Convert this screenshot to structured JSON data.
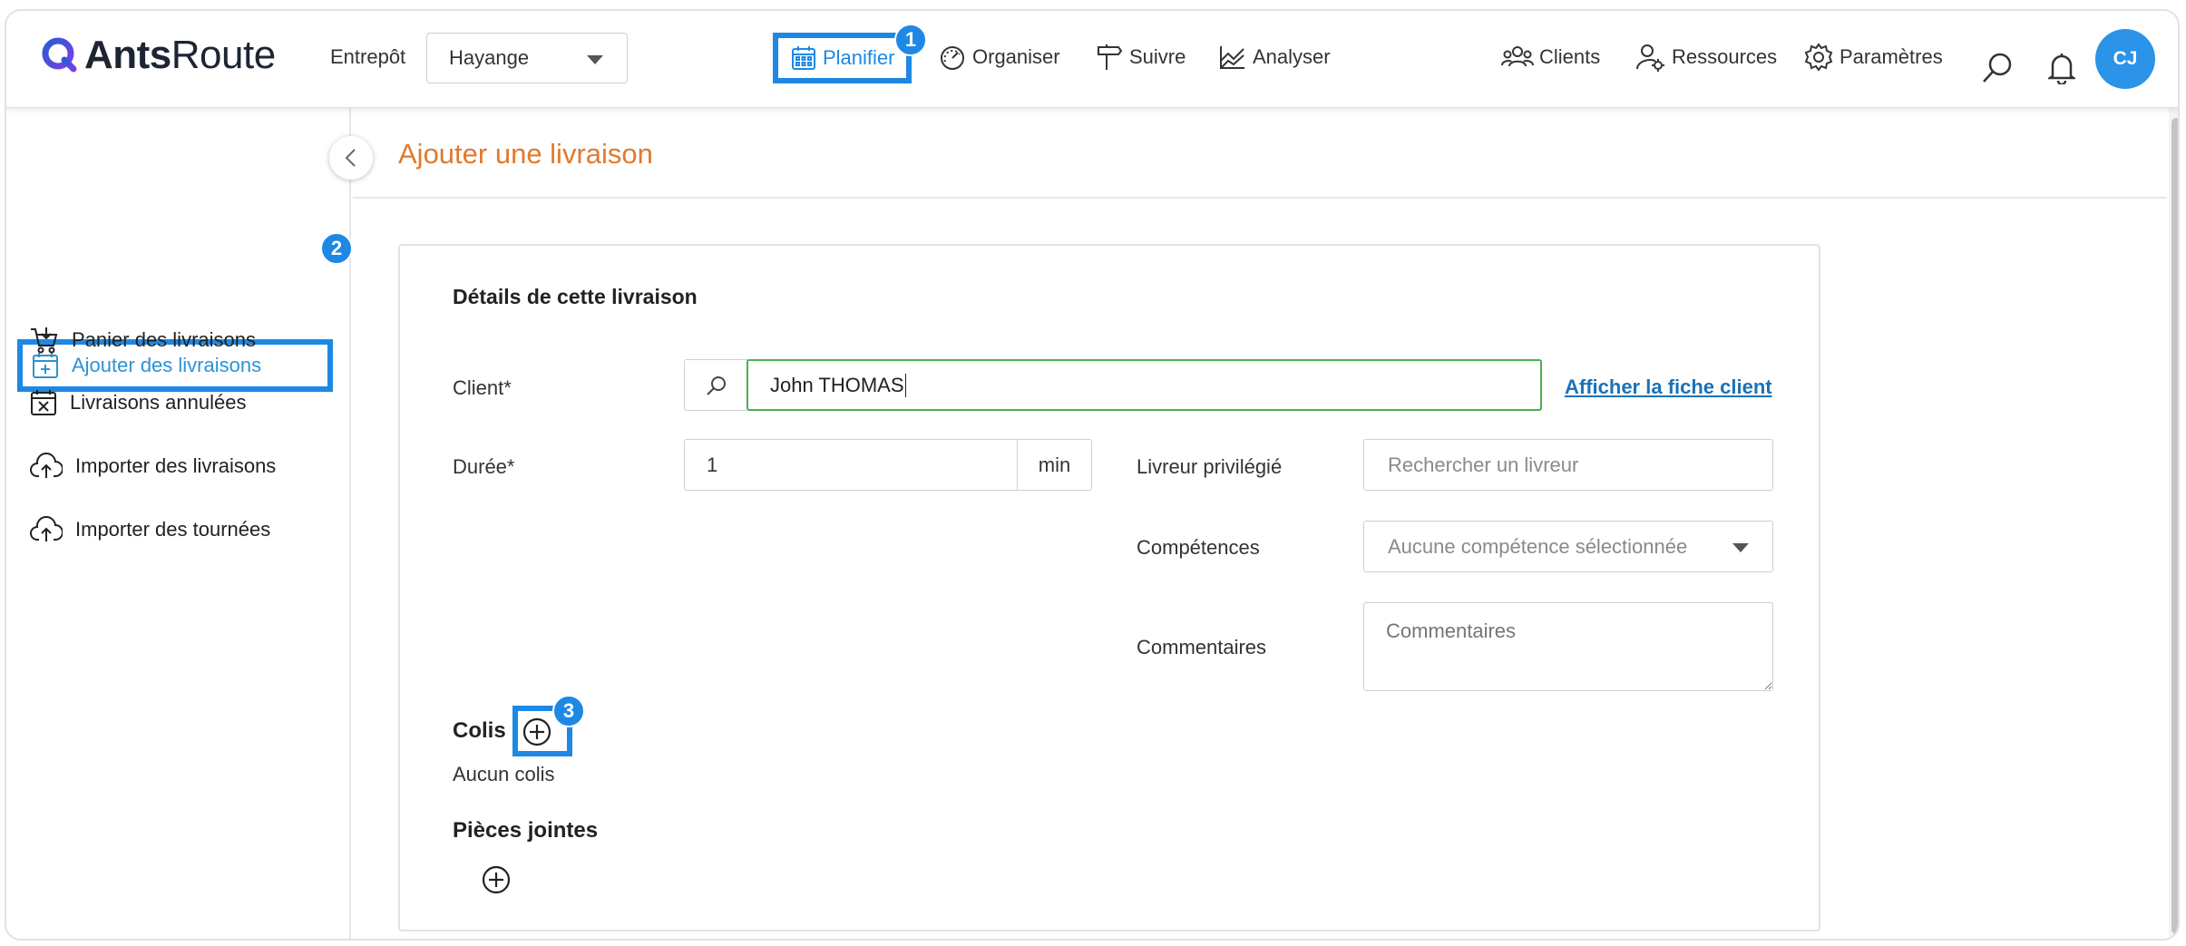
{
  "header": {
    "brand_bold": "Ants",
    "brand_rest": "Route",
    "warehouse_label": "Entrepôt",
    "warehouse_value": "Hayange",
    "nav": [
      {
        "label": "Planifier",
        "icon": "calendar-icon",
        "active": true
      },
      {
        "label": "Organiser",
        "icon": "gauge-icon"
      },
      {
        "label": "Suivre",
        "icon": "signpost-icon"
      },
      {
        "label": "Analyser",
        "icon": "chart-icon"
      }
    ],
    "right_nav": [
      {
        "label": "Clients",
        "icon": "users-icon"
      },
      {
        "label": "Ressources",
        "icon": "user-gear-icon"
      },
      {
        "label": "Paramètres",
        "icon": "gear-icon"
      }
    ],
    "avatar_initials": "CJ"
  },
  "badges": {
    "one": "1",
    "two": "2",
    "three": "3"
  },
  "sidebar": {
    "items": [
      {
        "label": "Ajouter des livraisons",
        "icon": "calendar-plus-icon",
        "active": true
      },
      {
        "label": "Panier des livraisons",
        "icon": "cart-icon"
      },
      {
        "label": "Livraisons annulées",
        "icon": "calendar-x-icon"
      },
      {
        "label": "Importer des livraisons",
        "icon": "cloud-upload-icon"
      },
      {
        "label": "Importer des tournées",
        "icon": "cloud-upload-icon"
      }
    ]
  },
  "main": {
    "page_title": "Ajouter une livraison",
    "section_title": "Détails de cette livraison",
    "client": {
      "label": "Client*",
      "value": "John THOMAS",
      "link": "Afficher la fiche client"
    },
    "duration": {
      "label": "Durée*",
      "value": "1",
      "unit": "min"
    },
    "driver": {
      "label": "Livreur privilégié",
      "placeholder": "Rechercher un livreur"
    },
    "skills": {
      "label": "Compétences",
      "value": "Aucune compétence sélectionnée"
    },
    "comments": {
      "label": "Commentaires",
      "placeholder": "Commentaires"
    },
    "parcels": {
      "title": "Colis",
      "empty": "Aucun colis"
    },
    "attachments": {
      "title": "Pièces jointes"
    }
  },
  "colors": {
    "accent": "#1e88e5",
    "title": "#e07a2e",
    "link": "#1b72b8",
    "valid": "#4caf50"
  }
}
